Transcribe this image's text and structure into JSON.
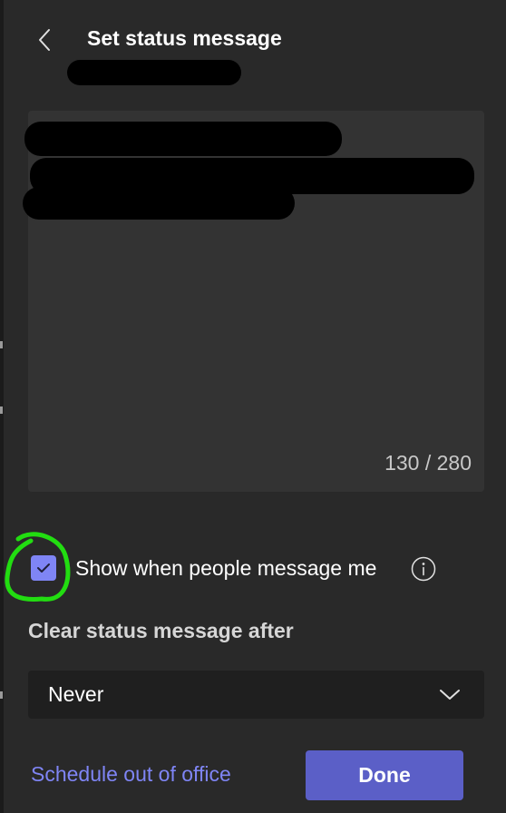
{
  "header": {
    "title": "Set status message",
    "back_icon": "chevron-left-icon"
  },
  "message": {
    "char_counter": "130 / 280"
  },
  "show_when_messaged": {
    "checked": true,
    "label": "Show when people message me",
    "info_icon": "info-icon"
  },
  "clear_after": {
    "label": "Clear status message after",
    "selected": "Never",
    "chevron_icon": "chevron-down-icon"
  },
  "footer": {
    "schedule_link": "Schedule out of office",
    "done_label": "Done"
  },
  "colors": {
    "background": "#292929",
    "input_background": "#333333",
    "select_background": "#1f1f1f",
    "accent": "#7f85f5",
    "primary_button": "#5b5fc7",
    "annotation": "#22dd11"
  }
}
